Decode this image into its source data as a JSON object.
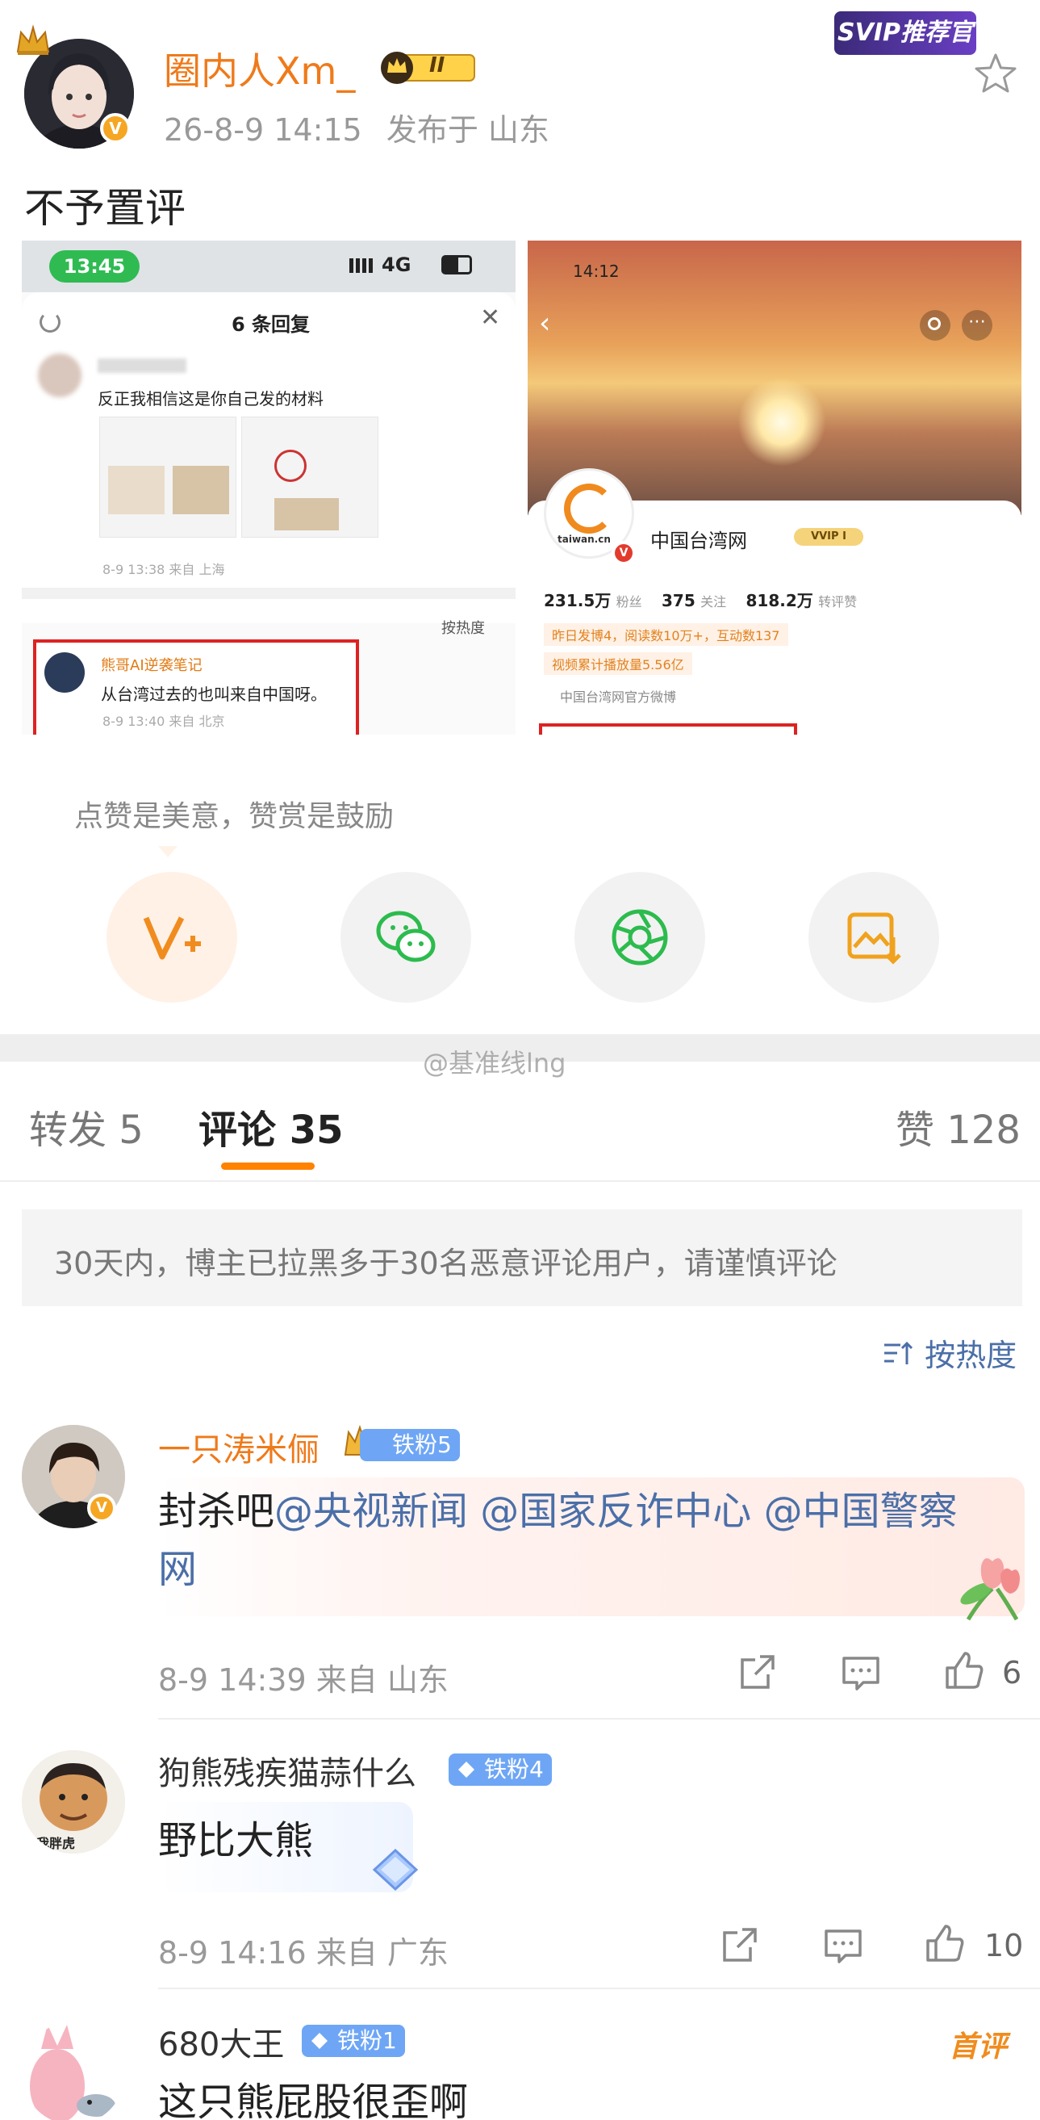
{
  "post": {
    "poster_name": "圈内人Xm_",
    "level_label": "II",
    "svip_label": "SVIP推荐官",
    "timestamp": "26-8-9 14:15",
    "location": "发布于 山东",
    "text": "不予置评"
  },
  "left_image": {
    "status_time": "13:45",
    "status_signal": "4G",
    "panel_title": "6 条回复",
    "reply_text": "反正我相信这是你自己发的材料",
    "reply_meta": "8-9 13:38 来自 上海",
    "sort_label": "按热度",
    "sub_name": "熊哥AI逆袭笔记",
    "sub_text": "从台湾过去的也叫来自中国呀。",
    "sub_meta": "8-9 13:40 来自 北京"
  },
  "right_image": {
    "status_time": "14:12",
    "logo_text": "taiwan.cn",
    "account_name": "中国台湾网",
    "vip_label": "VVIP I",
    "followers_num": "231.5万",
    "followers_label": "粉丝",
    "following_num": "375",
    "following_label": "关注",
    "reposts_num": "818.2万",
    "reposts_label": "转评赞",
    "stat_line1": "昨日发博4，阅读数10万+，互动数137",
    "stat_line2": "视频累计播放量5.56亿",
    "official_label": "中国台湾网官方微博"
  },
  "reward": {
    "text": "点赞是美意，赞赏是鼓励"
  },
  "watermark": "@基准线lng",
  "tabs": {
    "repost": "转发 5",
    "comment": "评论 35",
    "like": "赞 128"
  },
  "notice": "30天内，博主已拉黑多于30名恶意评论用户，请谨慎评论",
  "sort": "按热度",
  "comments": [
    {
      "name": "一只涛米俪",
      "badge": "铁粉5",
      "text_prefix": "封杀吧",
      "mentions": [
        "@央视新闻",
        "@国家反诈中心",
        "@中国警察网"
      ],
      "meta": "8-9 14:39  来自 山东",
      "likes": "6"
    },
    {
      "name": "狗熊残疾猫蒜什么",
      "badge": "铁粉4",
      "avatar_caption": "我胖虎",
      "text": "野比大熊",
      "meta": "8-9 14:16  来自 广东",
      "likes": "10"
    },
    {
      "name": "680大王",
      "badge": "铁粉1",
      "tag": "首评",
      "text": "这只熊屁股很歪啊"
    }
  ],
  "colors": {
    "accent_orange": "#ff8200",
    "name_orange": "#ef7a1a",
    "link_blue": "#4b6fa8",
    "badge_blue": "#6ea6f5"
  }
}
